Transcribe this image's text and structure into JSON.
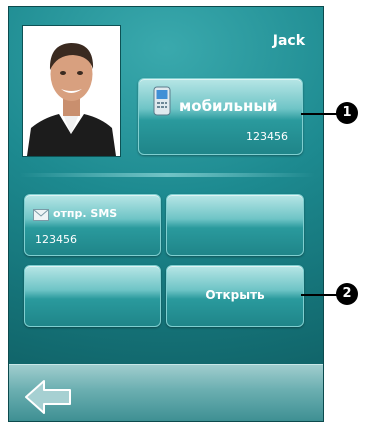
{
  "contact": {
    "name": "Jack"
  },
  "actions": {
    "mobile": {
      "label": "мобильный",
      "number": "123456"
    },
    "sms": {
      "label": "отпр. SMS",
      "number": "123456"
    },
    "open": {
      "label": "Открыть"
    }
  },
  "callouts": [
    "1",
    "2"
  ],
  "icons": {
    "mobile": "mobile-phone-icon",
    "sms": "envelope-icon",
    "back": "back-arrow-icon"
  },
  "colors": {
    "background": "#1d8a90",
    "tile": "#4fb5b8",
    "text": "#ffffff"
  }
}
